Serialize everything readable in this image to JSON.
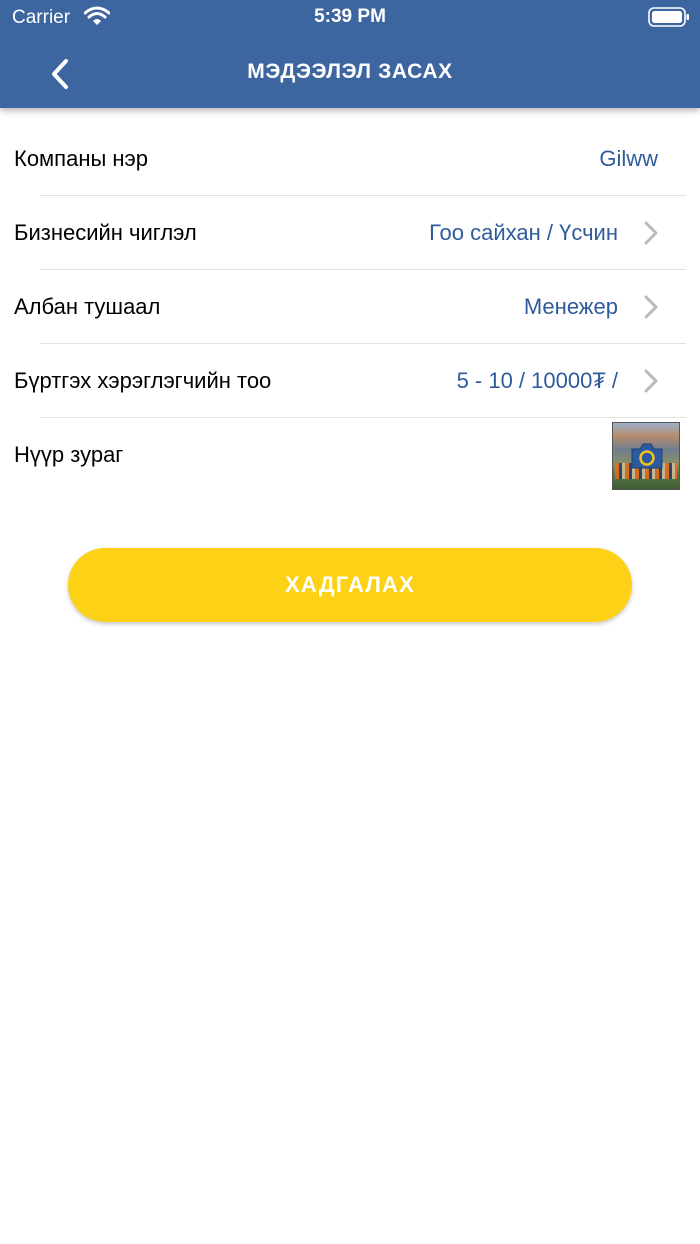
{
  "status_bar": {
    "carrier": "Carrier",
    "time": "5:39 PM"
  },
  "nav": {
    "title": "МЭДЭЭЛЭЛ ЗАСАХ"
  },
  "form": {
    "company_name": {
      "label": "Компаны нэр",
      "value": "Gilww"
    },
    "business_direction": {
      "label": "Бизнесийн чиглэл",
      "value": "Гоо сайхан / Үсчин"
    },
    "position": {
      "label": "Албан тушаал",
      "value": "Менежер"
    },
    "user_count": {
      "label": "Бүртгэх хэрэглэгчийн тоо",
      "value": "5 - 10 / 10000₮ /"
    },
    "cover_photo": {
      "label": "Нүүр зураг"
    }
  },
  "save_button": {
    "label": "ХАДГАЛАХ"
  },
  "colors": {
    "header_bg": "#3d65a0",
    "value_text": "#2f5b9c",
    "button_bg": "#fcd116",
    "chevron": "#b9b9be"
  },
  "icons": {
    "back": "chevron-left-icon",
    "row_chevron": "chevron-right-icon",
    "camera": "camera-icon",
    "wifi": "wifi-icon",
    "battery": "battery-icon"
  }
}
